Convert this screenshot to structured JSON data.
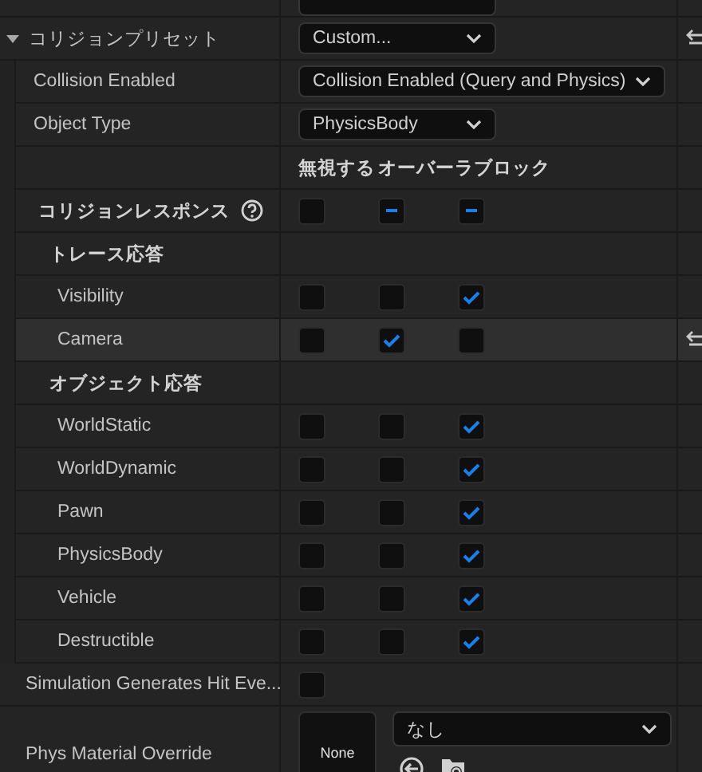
{
  "preset": {
    "label": "コリジョンプリセット",
    "expanded": true,
    "value": "Custom...",
    "reset": true
  },
  "properties": [
    {
      "label": "Collision Enabled",
      "value": "Collision Enabled (Query and Physics)"
    },
    {
      "label": "Object Type",
      "value": "PhysicsBody"
    }
  ],
  "response_headers": [
    "無視する",
    "オーバーラ",
    "ブロック"
  ],
  "collision_responses": {
    "label": "コリジョンレスポンス",
    "boxes": [
      {
        "checked": false,
        "mixed": false
      },
      {
        "mixed": true
      },
      {
        "mixed": true
      }
    ]
  },
  "groups": [
    {
      "label": "トレース応答",
      "channels": [
        {
          "name": "Visibility",
          "highlighted": false,
          "reset": false,
          "boxes": [
            {
              "checked": false
            },
            {
              "checked": false
            },
            {
              "checked": true
            }
          ]
        },
        {
          "name": "Camera",
          "highlighted": true,
          "reset": true,
          "boxes": [
            {
              "checked": false
            },
            {
              "checked": true
            },
            {
              "checked": false
            }
          ]
        }
      ]
    },
    {
      "label": "オブジェクト応答",
      "channels": [
        {
          "name": "WorldStatic",
          "highlighted": false,
          "reset": false,
          "boxes": [
            {
              "checked": false
            },
            {
              "checked": false
            },
            {
              "checked": true
            }
          ]
        },
        {
          "name": "WorldDynamic",
          "highlighted": false,
          "reset": false,
          "boxes": [
            {
              "checked": false
            },
            {
              "checked": false
            },
            {
              "checked": true
            }
          ]
        },
        {
          "name": "Pawn",
          "highlighted": false,
          "reset": false,
          "boxes": [
            {
              "checked": false
            },
            {
              "checked": false
            },
            {
              "checked": true
            }
          ]
        },
        {
          "name": "PhysicsBody",
          "highlighted": false,
          "reset": false,
          "boxes": [
            {
              "checked": false
            },
            {
              "checked": false
            },
            {
              "checked": true
            }
          ]
        },
        {
          "name": "Vehicle",
          "highlighted": false,
          "reset": false,
          "boxes": [
            {
              "checked": false
            },
            {
              "checked": false
            },
            {
              "checked": true
            }
          ]
        },
        {
          "name": "Destructible",
          "highlighted": false,
          "reset": false,
          "boxes": [
            {
              "checked": false
            },
            {
              "checked": false
            },
            {
              "checked": true
            }
          ]
        }
      ]
    }
  ],
  "simulation_hit_events": {
    "label": "Simulation Generates Hit Eve...",
    "checked": false
  },
  "phys_material": {
    "label": "Phys Material Override",
    "thumbnail": "None",
    "value": "なし"
  }
}
